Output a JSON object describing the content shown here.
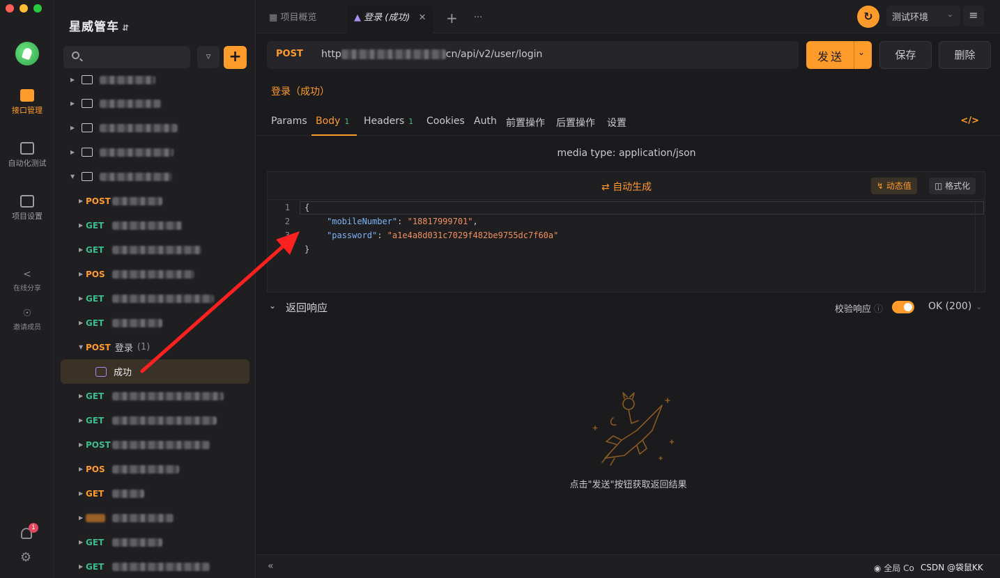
{
  "sidebar_rail": {
    "items": [
      {
        "label": "接口管理",
        "icon": "api-manage-icon"
      },
      {
        "label": "自动化测试",
        "icon": "automation-icon"
      },
      {
        "label": "项目设置",
        "icon": "project-settings-icon"
      }
    ],
    "share_label": "在线分享",
    "invite_label": "邀请成员",
    "notification_count": "1"
  },
  "tree": {
    "project_name": "星威管车",
    "login_group": {
      "method": "POST",
      "name": "登录",
      "count": "(1)"
    },
    "selected_case": "成功",
    "methods": [
      "POST",
      "GET",
      "GET",
      "POS",
      "GET",
      "GET",
      "GET",
      "GET",
      "POST",
      "POS",
      "GET",
      "GET"
    ]
  },
  "tabs": [
    {
      "label": "项目概览",
      "icon": "grid-icon"
    },
    {
      "label": "登录 (成功)",
      "icon": "case-icon",
      "active": true
    }
  ],
  "environment": {
    "label": "测试环境"
  },
  "request": {
    "method": "POST",
    "url_prefix": "http",
    "url_suffix": "cn/api/v2/user/login",
    "send_label": "发送",
    "save_label": "保存",
    "delete_label": "删除",
    "title": "登录（成功）"
  },
  "subtabs": [
    {
      "label": "Params"
    },
    {
      "label": "Body",
      "badge": "1",
      "active": true
    },
    {
      "label": "Headers",
      "badge": "1"
    },
    {
      "label": "Cookies"
    },
    {
      "label": "Auth"
    },
    {
      "label": "前置操作"
    },
    {
      "label": "后置操作"
    },
    {
      "label": "设置"
    }
  ],
  "body": {
    "media_type": "media type: application/json",
    "auto_generate": "自动生成",
    "dynamic_value": "动态值",
    "format": "格式化",
    "line_numbers": [
      "1",
      "2",
      "3"
    ],
    "lines": {
      "open": "{",
      "k1": "\"mobileNumber\"",
      "v1": "\"18817999701\"",
      "k2": "\"password\"",
      "v2": "\"a1e4a8d031c7029f482be9755dc7f60a\"",
      "close": "}"
    }
  },
  "response": {
    "title": "返回响应",
    "validate_label": "校验响应",
    "status": "OK (200)",
    "empty_hint": "点击\"发送\"按钮获取返回结果"
  },
  "footer": {
    "global_label": "全局 Co",
    "watermark": "CSDN @袋鼠KK"
  },
  "colors": {
    "accent": "#ff9b2a",
    "get": "#3dbd8c",
    "annotation_arrow": "#ff2020"
  }
}
